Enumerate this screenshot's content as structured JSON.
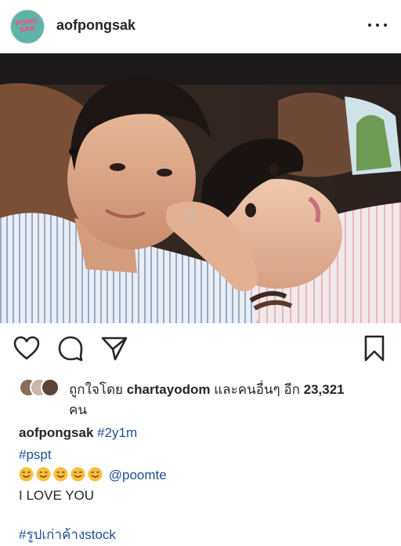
{
  "post": {
    "username": "aofpongsak",
    "avatar_text_line1": "PONG",
    "avatar_text_line2": "SAK"
  },
  "likes": {
    "prefix": "ถูกใจโดย",
    "user": "chartayodom",
    "middle": "และคนอื่นๆ อีก",
    "count": "23,321",
    "suffix": "คน"
  },
  "caption": {
    "username": "aofpongsak",
    "hashtag1": "#2y1m",
    "hashtag2": "#pspt",
    "emoji_name": "smiling-face-with-smiling-eyes",
    "emoji_count": 5,
    "mention": "@poomte",
    "text": "I LOVE YOU",
    "hashtag3": "#รูปเก่าค้างstock"
  },
  "icons": [
    "more-icon",
    "heart-icon",
    "comment-icon",
    "share-icon",
    "bookmark-icon"
  ],
  "colors": {
    "text": "#262626",
    "link": "#1d4f91",
    "avatar_bg": "#5fb4a8",
    "avatar_text": "#f04f8a",
    "emoji": "#f7c03a"
  }
}
